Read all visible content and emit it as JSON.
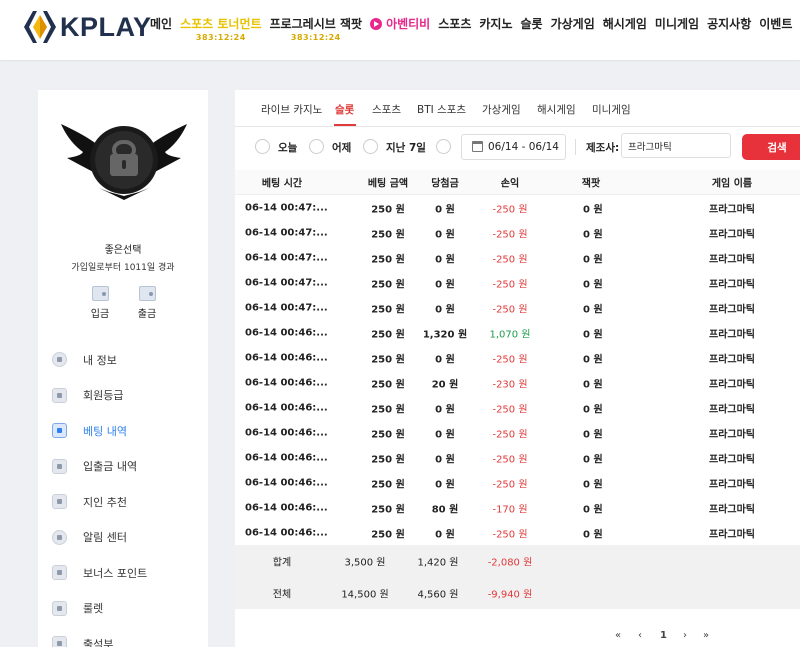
{
  "header": {
    "logo_text": "KPLAY",
    "nav": [
      {
        "label": "메인",
        "style": "normal"
      },
      {
        "label": "스포츠 토너먼트",
        "style": "highlight",
        "sub": "383:12:24"
      },
      {
        "label": "프로그레시브 잭팟",
        "style": "normal",
        "sub": "383:12:24"
      },
      {
        "label": "아벤티비",
        "style": "pink"
      },
      {
        "label": "스포츠",
        "style": "normal"
      },
      {
        "label": "카지노",
        "style": "normal"
      },
      {
        "label": "슬롯",
        "style": "normal"
      },
      {
        "label": "가상게임",
        "style": "normal"
      },
      {
        "label": "해시게임",
        "style": "normal"
      },
      {
        "label": "미니게임",
        "style": "normal"
      },
      {
        "label": "공지사항",
        "style": "normal"
      },
      {
        "label": "이벤트",
        "style": "normal"
      }
    ]
  },
  "sidebar": {
    "username": "좋은선택",
    "member_days": "가입일로부터 1011일 경과",
    "deposit": "입금",
    "withdraw": "출금",
    "menu": [
      {
        "label": "내 정보",
        "icon": "user-icon",
        "active": false
      },
      {
        "label": "회원등급",
        "icon": "grade-icon",
        "active": false
      },
      {
        "label": "베팅 내역",
        "icon": "betting-history-icon",
        "active": true
      },
      {
        "label": "입출금 내역",
        "icon": "transaction-icon",
        "active": false
      },
      {
        "label": "지인 추천",
        "icon": "referral-icon",
        "active": false
      },
      {
        "label": "알림 센터",
        "icon": "notification-icon",
        "active": false
      },
      {
        "label": "보너스 포인트",
        "icon": "bonus-point-icon",
        "active": false
      },
      {
        "label": "룰렛",
        "icon": "roulette-icon",
        "active": false
      },
      {
        "label": "출석부",
        "icon": "attendance-icon",
        "active": false
      }
    ]
  },
  "tabs": [
    {
      "label": "라이브 카지노",
      "active": false
    },
    {
      "label": "슬롯",
      "active": true
    },
    {
      "label": "스포츠",
      "active": false
    },
    {
      "label": "BTI 스포츠",
      "active": false
    },
    {
      "label": "가상게임",
      "active": false
    },
    {
      "label": "해시게임",
      "active": false
    },
    {
      "label": "미니게임",
      "active": false
    }
  ],
  "filters": {
    "today": "오늘",
    "yesterday": "어제",
    "last7": "지난 7일",
    "date_range": "06/14 - 06/14",
    "provider_label": "제조사:",
    "provider_value": "프라그마틱",
    "search_label": "검색"
  },
  "table": {
    "headers": [
      "베팅 시간",
      "베팅 금액",
      "당첨금",
      "손익",
      "잭팟",
      "게임 이름"
    ],
    "rows": [
      {
        "time": "06-14 00:47:...",
        "bet": "250 원",
        "win": "0 원",
        "pl": "-250 원",
        "jackpot": "0 원",
        "game": "프라그마틱",
        "pl_sign": "neg"
      },
      {
        "time": "06-14 00:47:...",
        "bet": "250 원",
        "win": "0 원",
        "pl": "-250 원",
        "jackpot": "0 원",
        "game": "프라그마틱",
        "pl_sign": "neg"
      },
      {
        "time": "06-14 00:47:...",
        "bet": "250 원",
        "win": "0 원",
        "pl": "-250 원",
        "jackpot": "0 원",
        "game": "프라그마틱",
        "pl_sign": "neg"
      },
      {
        "time": "06-14 00:47:...",
        "bet": "250 원",
        "win": "0 원",
        "pl": "-250 원",
        "jackpot": "0 원",
        "game": "프라그마틱",
        "pl_sign": "neg"
      },
      {
        "time": "06-14 00:47:...",
        "bet": "250 원",
        "win": "0 원",
        "pl": "-250 원",
        "jackpot": "0 원",
        "game": "프라그마틱",
        "pl_sign": "neg"
      },
      {
        "time": "06-14 00:46:...",
        "bet": "250 원",
        "win": "1,320 원",
        "pl": "1,070 원",
        "jackpot": "0 원",
        "game": "프라그마틱",
        "pl_sign": "pos"
      },
      {
        "time": "06-14 00:46:...",
        "bet": "250 원",
        "win": "0 원",
        "pl": "-250 원",
        "jackpot": "0 원",
        "game": "프라그마틱",
        "pl_sign": "neg"
      },
      {
        "time": "06-14 00:46:...",
        "bet": "250 원",
        "win": "20 원",
        "pl": "-230 원",
        "jackpot": "0 원",
        "game": "프라그마틱",
        "pl_sign": "neg"
      },
      {
        "time": "06-14 00:46:...",
        "bet": "250 원",
        "win": "0 원",
        "pl": "-250 원",
        "jackpot": "0 원",
        "game": "프라그마틱",
        "pl_sign": "neg"
      },
      {
        "time": "06-14 00:46:...",
        "bet": "250 원",
        "win": "0 원",
        "pl": "-250 원",
        "jackpot": "0 원",
        "game": "프라그마틱",
        "pl_sign": "neg"
      },
      {
        "time": "06-14 00:46:...",
        "bet": "250 원",
        "win": "0 원",
        "pl": "-250 원",
        "jackpot": "0 원",
        "game": "프라그마틱",
        "pl_sign": "neg"
      },
      {
        "time": "06-14 00:46:...",
        "bet": "250 원",
        "win": "0 원",
        "pl": "-250 원",
        "jackpot": "0 원",
        "game": "프라그마틱",
        "pl_sign": "neg"
      },
      {
        "time": "06-14 00:46:...",
        "bet": "250 원",
        "win": "80 원",
        "pl": "-170 원",
        "jackpot": "0 원",
        "game": "프라그마틱",
        "pl_sign": "neg"
      },
      {
        "time": "06-14 00:46:...",
        "bet": "250 원",
        "win": "0 원",
        "pl": "-250 원",
        "jackpot": "0 원",
        "game": "프라그마틱",
        "pl_sign": "neg"
      }
    ],
    "summary": [
      {
        "label": "합계",
        "bet": "3,500 원",
        "win": "1,420 원",
        "pl": "-2,080 원"
      },
      {
        "label": "전체",
        "bet": "14,500 원",
        "win": "4,560 원",
        "pl": "-9,940 원"
      }
    ]
  },
  "pagination": {
    "first": "«",
    "prev": "‹",
    "current": "1",
    "next": "›",
    "last": "»"
  },
  "colors": {
    "accent_red": "#e8323b",
    "loss_red": "#e03a3a",
    "profit_green": "#1f9d4a",
    "active_blue": "#2f80ed",
    "brand_navy": "#21304d"
  }
}
